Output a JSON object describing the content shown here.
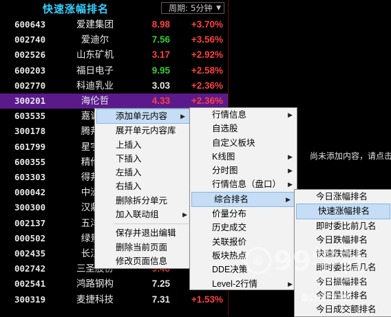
{
  "panel": {
    "title": "快速涨幅排名",
    "period_label": "周期: 5分钟",
    "rows": [
      {
        "code": "600643",
        "name": "爱建集团",
        "price": "8.98",
        "change": "+3.70%",
        "dir": "up"
      },
      {
        "code": "002740",
        "name": "爱迪尔",
        "price": "7.56",
        "change": "+3.56%",
        "dir": "down"
      },
      {
        "code": "002526",
        "name": "山东矿机",
        "price": "3.17",
        "change": "+2.92%",
        "dir": "up"
      },
      {
        "code": "600203",
        "name": "福日电子",
        "price": "9.95",
        "change": "+2.58%",
        "dir": "down"
      },
      {
        "code": "002770",
        "name": "科迪乳业",
        "price": "3.03",
        "change": "+2.36%",
        "dir": "flat"
      },
      {
        "code": "300201",
        "name": "海伦哲",
        "price": "4.33",
        "change": "+2.36%",
        "dir": "up",
        "selected": true
      },
      {
        "code": "603535",
        "name": "嘉诚国",
        "price": "",
        "change": "",
        "dir": "flat"
      },
      {
        "code": "300178",
        "name": "腾邦国",
        "price": "",
        "change": "",
        "dir": "flat"
      },
      {
        "code": "601799",
        "name": "星宇股",
        "price": "",
        "change": "",
        "dir": "flat"
      },
      {
        "code": "600355",
        "name": "精伦电",
        "price": "",
        "change": "",
        "dir": "flat"
      },
      {
        "code": "603303",
        "name": "得邦照",
        "price": "",
        "change": "",
        "dir": "flat"
      },
      {
        "code": "000042",
        "name": "中洲控",
        "price": "",
        "change": "",
        "dir": "flat"
      },
      {
        "code": "300300",
        "name": "汉鼎宇",
        "price": "",
        "change": "",
        "dir": "flat"
      },
      {
        "code": "002137",
        "name": "五洋停",
        "price": "",
        "change": "",
        "dir": "flat"
      },
      {
        "code": "000502",
        "name": "绿景控",
        "price": "",
        "change": "",
        "dir": "flat"
      },
      {
        "code": "002435",
        "name": "长江润",
        "price": "",
        "change": "",
        "dir": "flat"
      },
      {
        "code": "002742",
        "name": "三圣股份",
        "price": "9.48",
        "change": "",
        "dir": "up"
      },
      {
        "code": "002541",
        "name": "鸿路钢构",
        "price": "7.25",
        "change": "",
        "dir": "flat"
      },
      {
        "code": "300319",
        "name": "麦捷科技",
        "price": "7.31",
        "change": "+1.53%",
        "dir": "flat"
      }
    ]
  },
  "side_text": "尚未添加内容，请点击",
  "menu1": {
    "items": [
      {
        "label": "添加单元内容",
        "submenu": true,
        "highlight": true
      },
      {
        "label": "展开单元内容库"
      },
      {
        "label": "上插入"
      },
      {
        "label": "下插入"
      },
      {
        "label": "左插入"
      },
      {
        "label": "右插入"
      },
      {
        "label": "删除拆分单元"
      },
      {
        "label": "加入联动组",
        "submenu": true
      },
      {
        "sep": true
      },
      {
        "label": "保存并退出编辑"
      },
      {
        "label": "删除当前页面"
      },
      {
        "label": "修改页面信息"
      }
    ]
  },
  "menu2": {
    "items": [
      {
        "label": "行情信息",
        "submenu": true
      },
      {
        "label": "自选股"
      },
      {
        "label": "自定义板块"
      },
      {
        "label": "K线图",
        "submenu": true
      },
      {
        "label": "分时图",
        "submenu": true
      },
      {
        "label": "行情信息（盘口）",
        "submenu": true
      },
      {
        "label": "综合排名",
        "submenu": true,
        "highlight": true
      },
      {
        "label": "价量分布"
      },
      {
        "label": "历史成交"
      },
      {
        "label": "关联报价"
      },
      {
        "label": "板块热点"
      },
      {
        "label": "DDE决策"
      },
      {
        "label": "Level-2行情",
        "submenu": true
      }
    ]
  },
  "menu3": {
    "items": [
      {
        "label": "今日涨幅排名"
      },
      {
        "label": "快速涨幅排名",
        "highlight": true
      },
      {
        "label": "即时委比前几名"
      },
      {
        "label": "今日跌幅排名"
      },
      {
        "label": "快速跌幅排名"
      },
      {
        "label": "即时委比后几名"
      },
      {
        "label": "今日振幅排名"
      },
      {
        "label": "今日量比排名"
      },
      {
        "label": "今日成交额排名"
      }
    ]
  },
  "watermark": {
    "logo_text": "99学社",
    "url_text": "www.xue...cn",
    "bottom_text": "盘口技巧精解"
  }
}
